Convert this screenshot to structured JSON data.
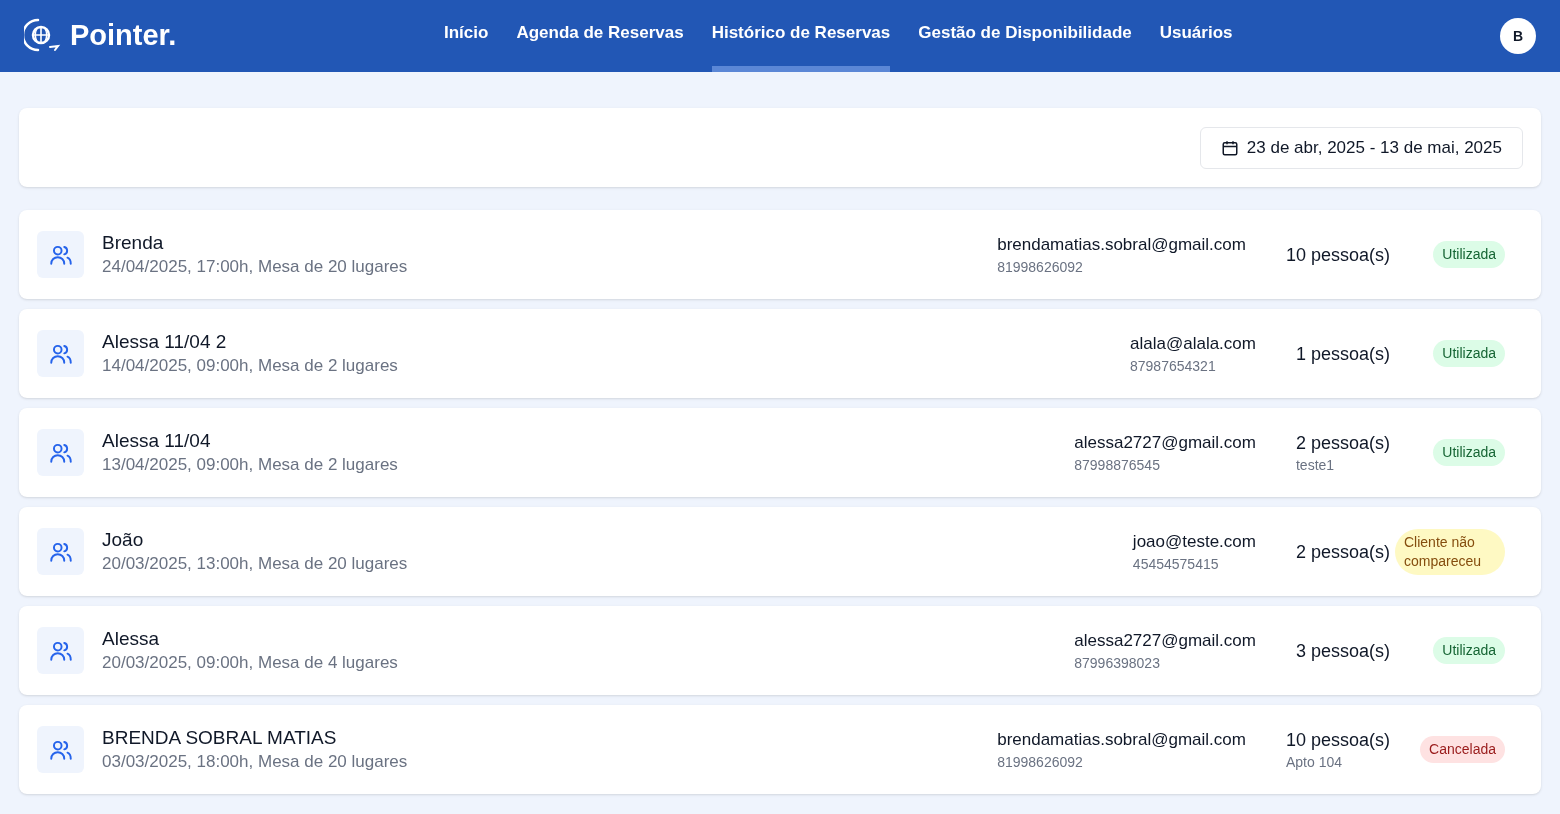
{
  "brand": {
    "name": "Pointer."
  },
  "nav": [
    {
      "label": "Início",
      "selected": false
    },
    {
      "label": "Agenda de Reservas",
      "selected": false
    },
    {
      "label": "Histórico de Reservas",
      "selected": true
    },
    {
      "label": "Gestão de Disponibilidade",
      "selected": false
    },
    {
      "label": "Usuários",
      "selected": false
    }
  ],
  "user": {
    "initial": "B"
  },
  "date_range": {
    "value": "23 de abr, 2025 - 13 de mai, 2025"
  },
  "reservations": [
    {
      "name": "Brenda",
      "details": "24/04/2025, 17:00h, Mesa de 20 lugares",
      "email": "brendamatias.sobral@gmail.com",
      "phone": "81998626092",
      "people": "10 pessoa(s)",
      "status": {
        "label": "Utilizada",
        "kind": "used"
      }
    },
    {
      "name": "Alessa 11/04 2",
      "details": "14/04/2025, 09:00h, Mesa de 2 lugares",
      "email": "alala@alala.com",
      "phone": "87987654321",
      "people": "1 pessoa(s)",
      "status": {
        "label": "Utilizada",
        "kind": "used"
      }
    },
    {
      "name": "Alessa 11/04",
      "details": "13/04/2025, 09:00h, Mesa de 2 lugares",
      "email": "alessa2727@gmail.com",
      "phone": "87998876545",
      "people": "2 pessoa(s)",
      "note": "teste1",
      "status": {
        "label": "Utilizada",
        "kind": "used"
      }
    },
    {
      "name": "João",
      "details": "20/03/2025, 13:00h, Mesa de 20 lugares",
      "email": "joao@teste.com",
      "phone": "45454575415",
      "people": "2 pessoa(s)",
      "status": {
        "label": "Cliente não compareceu",
        "kind": "no_show"
      }
    },
    {
      "name": "Alessa",
      "details": "20/03/2025, 09:00h, Mesa de 4 lugares",
      "email": "alessa2727@gmail.com",
      "phone": "87996398023",
      "people": "3 pessoa(s)",
      "status": {
        "label": "Utilizada",
        "kind": "used"
      }
    },
    {
      "name": "BRENDA SOBRAL MATIAS",
      "details": "03/03/2025, 18:00h, Mesa de 20 lugares",
      "email": "brendamatias.sobral@gmail.com",
      "phone": "81998626092",
      "people": "10 pessoa(s)",
      "note": "Apto 104",
      "status": {
        "label": "Cancelada",
        "kind": "cancelled"
      }
    }
  ]
}
